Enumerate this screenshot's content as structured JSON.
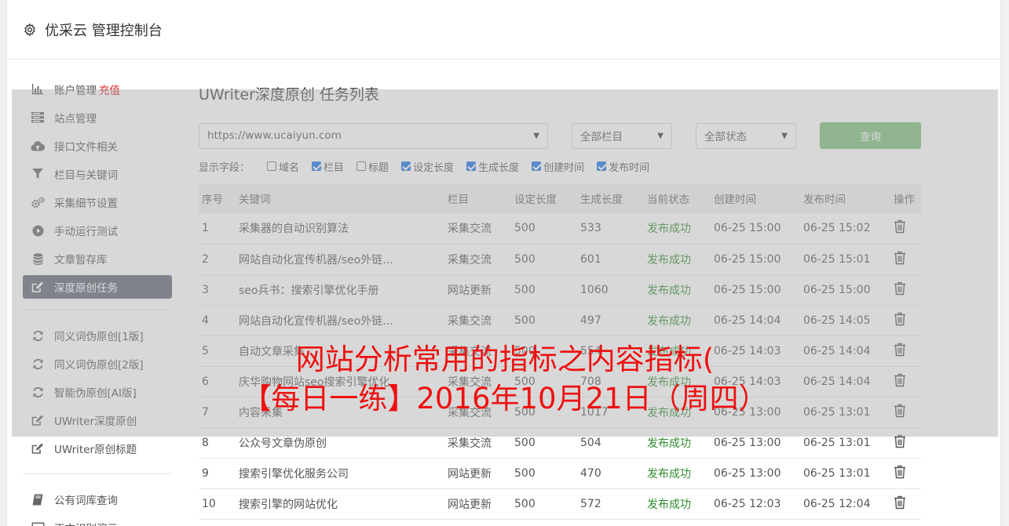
{
  "header": {
    "title": "优采云 管理控制台"
  },
  "sidebar": {
    "groups": [
      [
        {
          "name": "account",
          "label": "账户管理",
          "extra": "充值",
          "icon": "bar-chart-icon"
        },
        {
          "name": "sites",
          "label": "站点管理",
          "icon": "list-icon"
        },
        {
          "name": "api-files",
          "label": "接口文件相关",
          "icon": "cloud-upload-icon"
        },
        {
          "name": "columns-keywords",
          "label": "栏目与关键词",
          "icon": "filter-icon"
        },
        {
          "name": "collect-settings",
          "label": "采集细节设置",
          "icon": "gears-icon"
        },
        {
          "name": "manual-run",
          "label": "手动运行测试",
          "icon": "play-icon"
        },
        {
          "name": "article-store",
          "label": "文章暂存库",
          "icon": "database-icon"
        },
        {
          "name": "deep-original",
          "label": "深度原创任务",
          "icon": "edit-icon",
          "active": true
        }
      ],
      [
        {
          "name": "synonym-v1",
          "label": "同义词伪原创[1版]",
          "icon": "refresh-icon"
        },
        {
          "name": "synonym-v2",
          "label": "同义词伪原创[2版]",
          "icon": "refresh-icon"
        },
        {
          "name": "ai-rewrite",
          "label": "智能伪原创[AI版]",
          "icon": "refresh-icon"
        },
        {
          "name": "uwriter-deep",
          "label": "UWriter深度原创",
          "icon": "edit-icon"
        },
        {
          "name": "uwriter-title",
          "label": "UWriter原创标题",
          "icon": "edit-icon"
        }
      ],
      [
        {
          "name": "public-lexicon",
          "label": "公有词库查询",
          "icon": "book-icon"
        },
        {
          "name": "text-recognition",
          "label": "正文识别演示",
          "icon": "monitor-icon"
        }
      ]
    ]
  },
  "main": {
    "title": "UWriter深度原创 任务列表",
    "site_select": "https://www.ucaiyun.com",
    "column_select": "全部栏目",
    "status_select": "全部状态",
    "query_label": "查询",
    "fields_label": "显示字段：",
    "fields": [
      {
        "label": "域名",
        "checked": false
      },
      {
        "label": "栏目",
        "checked": true
      },
      {
        "label": "标题",
        "checked": false
      },
      {
        "label": "设定长度",
        "checked": true
      },
      {
        "label": "生成长度",
        "checked": true
      },
      {
        "label": "创建时间",
        "checked": true
      },
      {
        "label": "发布时间",
        "checked": true
      }
    ],
    "columns": [
      "序号",
      "关键词",
      "栏目",
      "设定长度",
      "生成长度",
      "当前状态",
      "创建时间",
      "发布时间",
      "操作"
    ],
    "rows": [
      [
        "1",
        "采集器的自动识别算法",
        "采集交流",
        "500",
        "533",
        "发布成功",
        "06-25 15:00",
        "06-25 15:02"
      ],
      [
        "2",
        "网站自动化宣传机器/seo外链...",
        "采集交流",
        "500",
        "601",
        "发布成功",
        "06-25 15:00",
        "06-25 15:01"
      ],
      [
        "3",
        "seo兵书：搜索引擎优化手册",
        "网站更新",
        "500",
        "1060",
        "发布成功",
        "06-25 15:00",
        "06-25 15:00"
      ],
      [
        "4",
        "网站自动化宣传机器/seo外链...",
        "采集交流",
        "500",
        "497",
        "发布成功",
        "06-25 14:04",
        "06-25 14:05"
      ],
      [
        "5",
        "自动文章采集",
        "采集交流",
        "500",
        "554",
        "发布成功",
        "06-25 14:03",
        "06-25 14:04"
      ],
      [
        "6",
        "庆华购物网站seo搜索引擎优化",
        "采集交流",
        "500",
        "708",
        "发布成功",
        "06-25 14:03",
        "06-25 14:04"
      ],
      [
        "7",
        "内容采集",
        "采集交流",
        "500",
        "1017",
        "发布成功",
        "06-25 13:00",
        "06-25 13:01"
      ],
      [
        "8",
        "公众号文章伪原创",
        "采集交流",
        "500",
        "504",
        "发布成功",
        "06-25 13:00",
        "06-25 13:01"
      ],
      [
        "9",
        "搜索引擎优化服务公司",
        "网站更新",
        "500",
        "470",
        "发布成功",
        "06-25 13:00",
        "06-25 13:01"
      ],
      [
        "10",
        "搜索引擎的网站优化",
        "网站更新",
        "500",
        "572",
        "发布成功",
        "06-25 12:03",
        "06-25 12:04"
      ]
    ]
  },
  "overlay": {
    "line1": "网站分析常用的指标之内容指标(",
    "line2": "【每日一练】2016年10月21日（周四）"
  },
  "colors": {
    "active_bg": "#5f6573",
    "query_button": "#7cbf7c",
    "status_ok": "#2e8b2e",
    "recharge": "#e02020",
    "overlay_text": "#ee1111"
  }
}
